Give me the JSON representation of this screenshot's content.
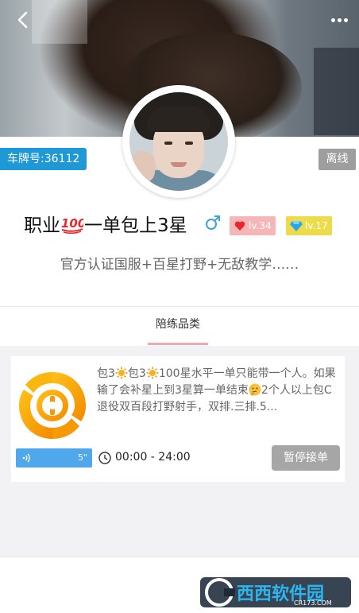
{
  "header": {
    "back_icon": "chevron-left-icon",
    "more_icon": "more-dots-icon"
  },
  "profile": {
    "plate_label": "车牌号:36112",
    "status": "离线",
    "name_part1": "职业",
    "name_part2": "一单包上3星",
    "gender": "male",
    "charm_level": "lv.34",
    "wealth_level": "lv.17",
    "signature": "官方认证国服+百星打野+无敌教学……",
    "colors": {
      "plate": "#1f98d6",
      "offline": "#9e9e9e",
      "charm": "#f6b5b7",
      "wealth": "#eddb4a",
      "gender": "#3aa3dc"
    }
  },
  "tabs": [
    {
      "label": "陪练品类",
      "active": true
    }
  ],
  "service_card": {
    "desc_seg1": "包3",
    "desc_seg2": "包3",
    "desc_seg3": "100星水平一单只能带一个人。如果输了会补星上到3星算一单结束",
    "desc_seg4": "2个人以上包C退役双百段打野射手，双排.三排.5...",
    "voice_duration": "5\"",
    "time_range": "00:00 - 24:00",
    "pause_label": "暂停接单"
  },
  "watermark": {
    "brand": "西西软件园",
    "site": "CR173.COM"
  }
}
